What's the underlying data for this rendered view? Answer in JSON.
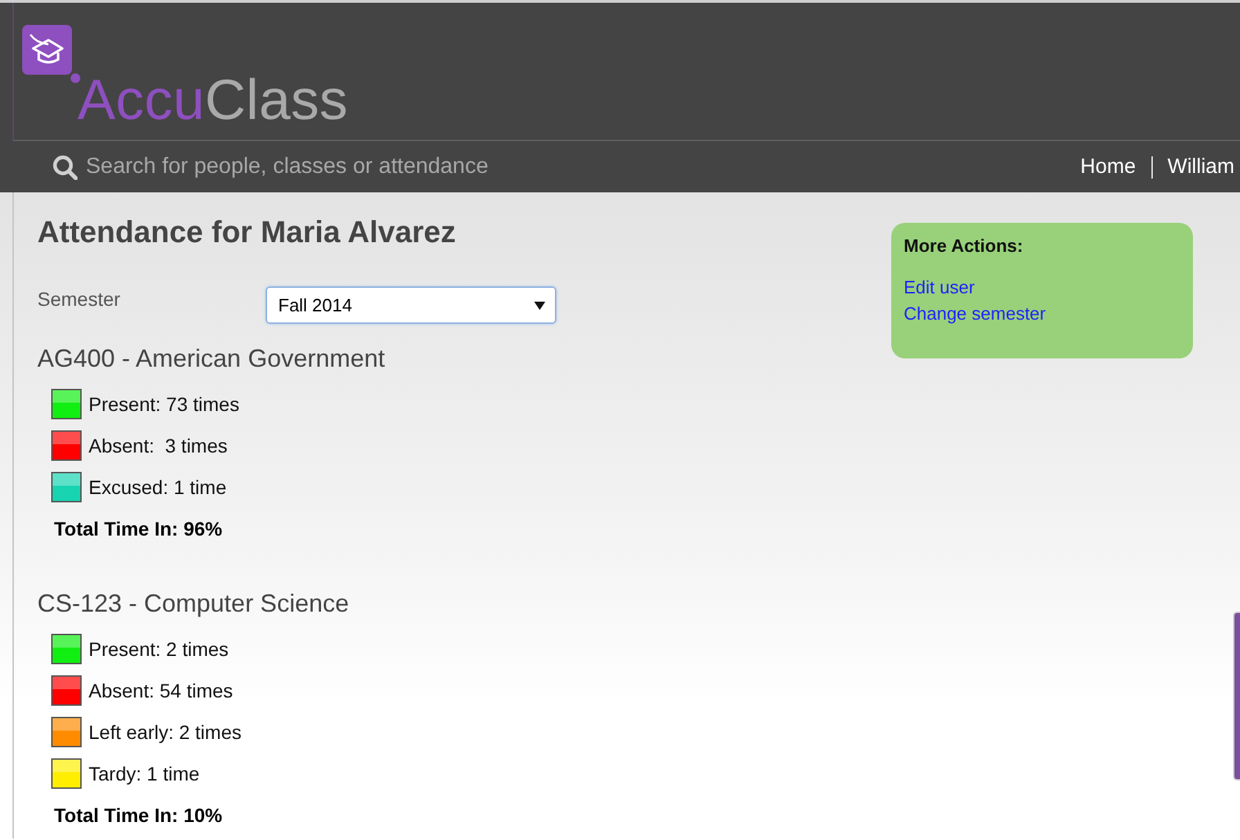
{
  "header": {
    "logo": {
      "part_1": "Accu",
      "part_2": "Class"
    },
    "search": {
      "placeholder": "Search for people, classes or attendance"
    },
    "nav": [
      {
        "label": "Home"
      },
      {
        "label": "William"
      }
    ]
  },
  "page": {
    "title": "Attendance for Maria Alvarez",
    "semester": {
      "label": "Semester",
      "value": "Fall 2014"
    }
  },
  "courses": [
    {
      "title": "AG400 - American Government",
      "records": [
        {
          "label": "Present: 73 times",
          "color": "#11ee11"
        },
        {
          "label": "Absent:  3 times",
          "color": "#ff0000"
        },
        {
          "label": "Excused: 1 time",
          "color": "#18d4b0"
        }
      ],
      "total": "Total Time In: 96%"
    },
    {
      "title": "CS-123 - Computer Science",
      "records": [
        {
          "label": "Present: 2 times",
          "color": "#11ee11"
        },
        {
          "label": "Absent: 54 times",
          "color": "#ff0000"
        },
        {
          "label": "Left early: 2 times",
          "color": "#ff8c00"
        },
        {
          "label": "Tardy: 1 time",
          "color": "#ffee00"
        }
      ],
      "total": "Total Time In: 10%"
    }
  ],
  "actions": {
    "title": "More Actions:",
    "links": [
      "Edit user",
      "Change semester"
    ]
  }
}
